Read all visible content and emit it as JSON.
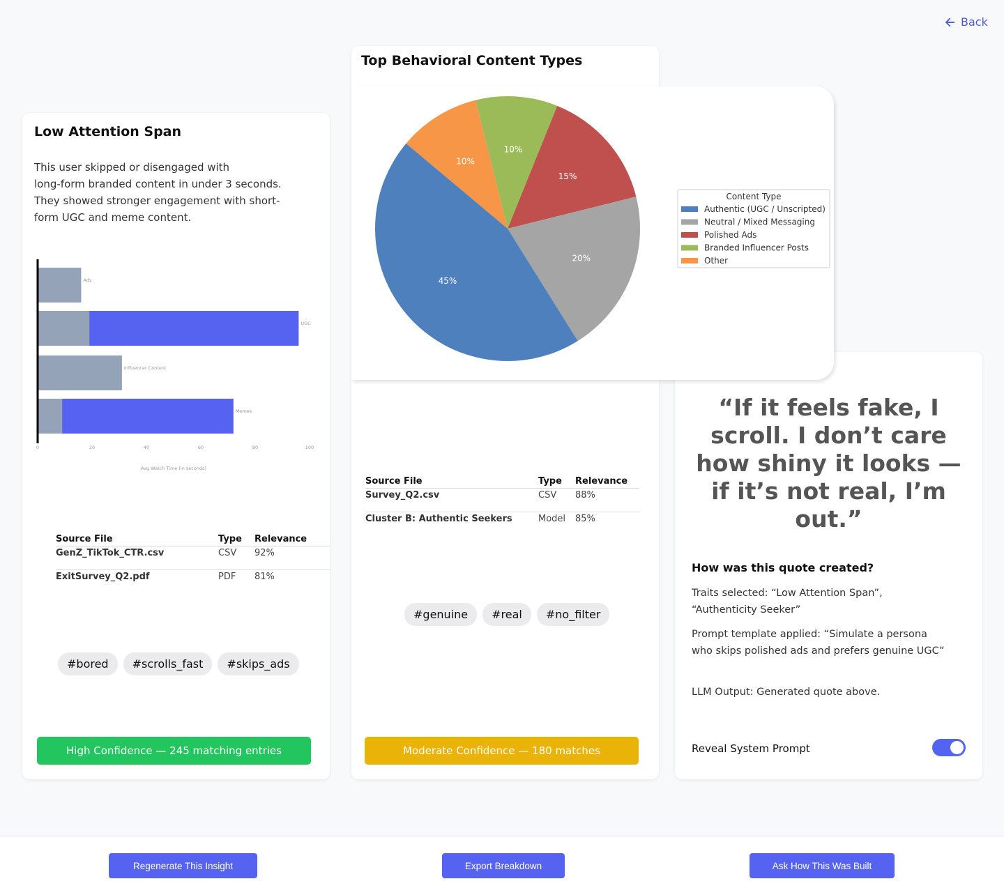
{
  "back": {
    "label": "Back"
  },
  "left_card": {
    "title": "Low Attention Span",
    "description_lines": [
      "This user skipped or disengaged with",
      "long-form branded content in under 3 seconds.",
      "They showed stronger engagement with short-",
      "form UGC and meme content."
    ],
    "table": {
      "headers": [
        "Source File",
        "Type",
        "Relevance"
      ],
      "rows": [
        [
          "GenZ_TikTok_CTR.csv",
          "CSV",
          "92%"
        ],
        [
          "ExitSurvey_Q2.pdf",
          "PDF",
          "81%"
        ]
      ]
    },
    "tags": [
      "#bored",
      "#scrolls_fast",
      "#skips_ads"
    ],
    "confidence": {
      "label": "High Confidence — 245 matching entries",
      "color": "#22c55e"
    }
  },
  "middle_card": {
    "title": "Top Behavioral Content Types",
    "table": {
      "headers": [
        "Source File",
        "Type",
        "Relevance"
      ],
      "rows": [
        [
          "Survey_Q2.csv",
          "CSV",
          "88%"
        ],
        [
          "Cluster B: Authentic Seekers",
          "Model",
          "85%"
        ]
      ]
    },
    "tags": [
      "#genuine",
      "#real",
      "#no_filter"
    ],
    "confidence": {
      "label": "Moderate Confidence — 180 matches",
      "color": "#eab308"
    }
  },
  "right_card": {
    "quote": "“If it feels fake, I scroll. I don’t care how shiny it looks — if it’s not real, I’m out.”",
    "how_title": "How was this quote created?",
    "how_lines": [
      " Traits selected: “Low Attention Span”, “Authenticity Seeker”",
      "Prompt template applied: “Simulate a persona who skips polished ads and prefers genuine UGC”",
      "LLM Output: Generated quote above."
    ],
    "toggle_label": "Reveal System Prompt",
    "toggle_on": true
  },
  "bottom_buttons": {
    "regenerate": "Regenerate This Insight",
    "export": "Export Breakdown",
    "ask": "Ask How This Was Built"
  },
  "chart_data": [
    {
      "type": "bar",
      "orientation": "horizontal",
      "stacked": true,
      "xlabel": "Avg Watch Time (in seconds)",
      "xlim": [
        0,
        100
      ],
      "xticks": [
        0,
        20,
        40,
        60,
        80,
        100
      ],
      "categories": [
        "Ads",
        "UGC",
        "Influencer Content",
        "Memes"
      ],
      "series": [
        {
          "values": [
            16,
            19,
            31,
            9
          ],
          "color": "#94a3b8"
        },
        {
          "values": [
            0,
            77,
            0,
            63
          ],
          "color": "#5563f0"
        }
      ]
    },
    {
      "type": "pie",
      "legend_title": "Content Type",
      "legend_position": "right",
      "slices": [
        {
          "label": "Authentic (UGC / Unscripted)",
          "value": 45,
          "color": "#4e80bd"
        },
        {
          "label": "Neutral / Mixed Messaging",
          "value": 20,
          "color": "#a5a5a5"
        },
        {
          "label": "Polished Ads",
          "value": 15,
          "color": "#c0504d"
        },
        {
          "label": "Branded Influencer Posts",
          "value": 10,
          "color": "#9bbb59"
        },
        {
          "label": "Other",
          "value": 10,
          "color": "#f79646"
        }
      ]
    }
  ]
}
